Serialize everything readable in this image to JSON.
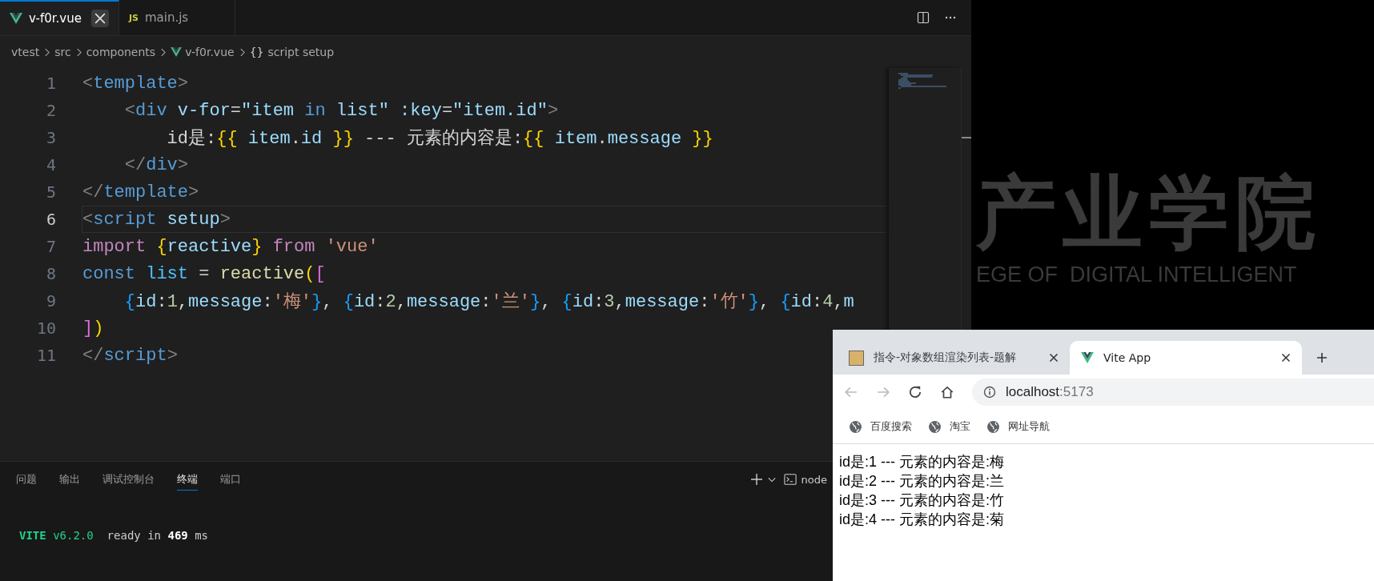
{
  "editor": {
    "tabs": [
      {
        "label": "v-f0r.vue",
        "kind": "vue",
        "selected": true
      },
      {
        "label": "main.js",
        "kind": "js",
        "icon_text": "JS",
        "selected": false
      }
    ],
    "breadcrumb": [
      {
        "label": "vtest",
        "kind": "folder"
      },
      {
        "label": "src",
        "kind": "folder"
      },
      {
        "label": "components",
        "kind": "folder"
      },
      {
        "label": "v-f0r.vue",
        "kind": "vue"
      },
      {
        "label": "script setup",
        "kind": "symbol",
        "icon_text": "{}"
      }
    ],
    "lines": [
      {
        "number": "1",
        "current": false,
        "tokens": [
          {
            "text": "<",
            "kind": "punct"
          },
          {
            "text": "template",
            "kind": "tag"
          },
          {
            "text": ">",
            "kind": "punct"
          }
        ]
      },
      {
        "number": "2",
        "current": false,
        "tokens": [
          {
            "text": "    <",
            "kind": "punct"
          },
          {
            "text": "div",
            "kind": "tag"
          },
          {
            "text": " v-for",
            "kind": "attr"
          },
          {
            "text": "=",
            "kind": "plain"
          },
          {
            "text": "\"item ",
            "kind": "value"
          },
          {
            "text": "in",
            "kind": "tag"
          },
          {
            "text": " list\"",
            "kind": "value"
          },
          {
            "text": " :key",
            "kind": "attr"
          },
          {
            "text": "=",
            "kind": "plain"
          },
          {
            "text": "\"item.id\"",
            "kind": "value"
          },
          {
            "text": ">",
            "kind": "punct"
          }
        ]
      },
      {
        "number": "3",
        "current": false,
        "tokens": [
          {
            "text": "        id是:",
            "kind": "plain"
          },
          {
            "text": "{{",
            "kind": "brace"
          },
          {
            "text": " item",
            "kind": "value"
          },
          {
            "text": ".",
            "kind": "plain"
          },
          {
            "text": "id",
            "kind": "value"
          },
          {
            "text": " }}",
            "kind": "brace"
          },
          {
            "text": " --- 元素的内容是:",
            "kind": "plain"
          },
          {
            "text": "{{",
            "kind": "brace"
          },
          {
            "text": " item",
            "kind": "value"
          },
          {
            "text": ".",
            "kind": "plain"
          },
          {
            "text": "message",
            "kind": "value"
          },
          {
            "text": " }}",
            "kind": "brace"
          }
        ]
      },
      {
        "number": "4",
        "current": false,
        "tokens": [
          {
            "text": "    </",
            "kind": "punct"
          },
          {
            "text": "div",
            "kind": "tag"
          },
          {
            "text": ">",
            "kind": "punct"
          }
        ]
      },
      {
        "number": "5",
        "current": false,
        "tokens": [
          {
            "text": "</",
            "kind": "punct"
          },
          {
            "text": "template",
            "kind": "tag"
          },
          {
            "text": ">",
            "kind": "punct"
          }
        ]
      },
      {
        "number": "6",
        "current": true,
        "tokens": [
          {
            "text": "<",
            "kind": "punct"
          },
          {
            "text": "script",
            "kind": "tag"
          },
          {
            "text": " setup",
            "kind": "attr"
          },
          {
            "text": ">",
            "kind": "punct"
          }
        ]
      },
      {
        "number": "7",
        "current": false,
        "tokens": [
          {
            "text": "import",
            "kind": "keyword"
          },
          {
            "text": " {",
            "kind": "brace"
          },
          {
            "text": "reactive",
            "kind": "value"
          },
          {
            "text": "}",
            "kind": "brace"
          },
          {
            "text": " from",
            "kind": "keyword"
          },
          {
            "text": " 'vue'",
            "kind": "string"
          }
        ]
      },
      {
        "number": "8",
        "current": false,
        "tokens": [
          {
            "text": "const",
            "kind": "tag"
          },
          {
            "text": " list",
            "kind": "constant"
          },
          {
            "text": " = ",
            "kind": "plain"
          },
          {
            "text": "reactive",
            "kind": "function"
          },
          {
            "text": "(",
            "kind": "brace"
          },
          {
            "text": "[",
            "kind": "bracket2"
          }
        ]
      },
      {
        "number": "9",
        "current": false,
        "tokens": [
          {
            "text": "    {",
            "kind": "bracket3"
          },
          {
            "text": "id",
            "kind": "value"
          },
          {
            "text": ":",
            "kind": "plain"
          },
          {
            "text": "1",
            "kind": "number"
          },
          {
            "text": ",",
            "kind": "plain"
          },
          {
            "text": "message",
            "kind": "value"
          },
          {
            "text": ":",
            "kind": "plain"
          },
          {
            "text": "'梅'",
            "kind": "string"
          },
          {
            "text": "}",
            "kind": "bracket3"
          },
          {
            "text": ", ",
            "kind": "plain"
          },
          {
            "text": "{",
            "kind": "bracket3"
          },
          {
            "text": "id",
            "kind": "value"
          },
          {
            "text": ":",
            "kind": "plain"
          },
          {
            "text": "2",
            "kind": "number"
          },
          {
            "text": ",",
            "kind": "plain"
          },
          {
            "text": "message",
            "kind": "value"
          },
          {
            "text": ":",
            "kind": "plain"
          },
          {
            "text": "'兰'",
            "kind": "string"
          },
          {
            "text": "}",
            "kind": "bracket3"
          },
          {
            "text": ", ",
            "kind": "plain"
          },
          {
            "text": "{",
            "kind": "bracket3"
          },
          {
            "text": "id",
            "kind": "value"
          },
          {
            "text": ":",
            "kind": "plain"
          },
          {
            "text": "3",
            "kind": "number"
          },
          {
            "text": ",",
            "kind": "plain"
          },
          {
            "text": "message",
            "kind": "value"
          },
          {
            "text": ":",
            "kind": "plain"
          },
          {
            "text": "'竹'",
            "kind": "string"
          },
          {
            "text": "}",
            "kind": "bracket3"
          },
          {
            "text": ", ",
            "kind": "plain"
          },
          {
            "text": "{",
            "kind": "bracket3"
          },
          {
            "text": "id",
            "kind": "value"
          },
          {
            "text": ":",
            "kind": "plain"
          },
          {
            "text": "4",
            "kind": "number"
          },
          {
            "text": ",",
            "kind": "plain"
          },
          {
            "text": "m",
            "kind": "value"
          }
        ]
      },
      {
        "number": "10",
        "current": false,
        "tokens": [
          {
            "text": "]",
            "kind": "bracket2"
          },
          {
            "text": ")",
            "kind": "brace"
          }
        ]
      },
      {
        "number": "11",
        "current": false,
        "tokens": [
          {
            "text": "</",
            "kind": "punct"
          },
          {
            "text": "script",
            "kind": "tag"
          },
          {
            "text": ">",
            "kind": "punct"
          }
        ]
      }
    ]
  },
  "panel": {
    "tabs": [
      {
        "label": "问题",
        "selected": false
      },
      {
        "label": "输出",
        "selected": false
      },
      {
        "label": "调试控制台",
        "selected": false
      },
      {
        "label": "终端",
        "selected": true
      },
      {
        "label": "端口",
        "selected": false
      }
    ],
    "shell": "node",
    "terminal": [
      {
        "tokens": [
          {
            "text": "VITE",
            "kind": "brand"
          },
          {
            "text": " v6.2.0",
            "kind": "version"
          },
          {
            "text": "  ready in ",
            "kind": "plain"
          },
          {
            "text": "469",
            "kind": "bold"
          },
          {
            "text": " ms",
            "kind": "plain"
          }
        ]
      }
    ]
  },
  "wallpaper": {
    "title": "产业学院",
    "subtitle": "EGE OF  DIGITAL INTELLIGENT"
  },
  "browser": {
    "tabs": [
      {
        "title": "指令-对象数组渲染列表-题解",
        "kind": "picture",
        "selected": false
      },
      {
        "title": "Vite App",
        "kind": "vue",
        "selected": true
      }
    ],
    "address": {
      "host": "localhost",
      "port": ":5173"
    },
    "back_disabled": true,
    "forward_disabled": true,
    "bookmarks": [
      "百度搜索",
      "淘宝",
      "网址导航"
    ],
    "content": [
      "id是:1 --- 元素的内容是:梅",
      "id是:2 --- 元素的内容是:兰",
      "id是:3 --- 元素的内容是:竹",
      "id是:4 --- 元素的内容是:菊"
    ]
  }
}
